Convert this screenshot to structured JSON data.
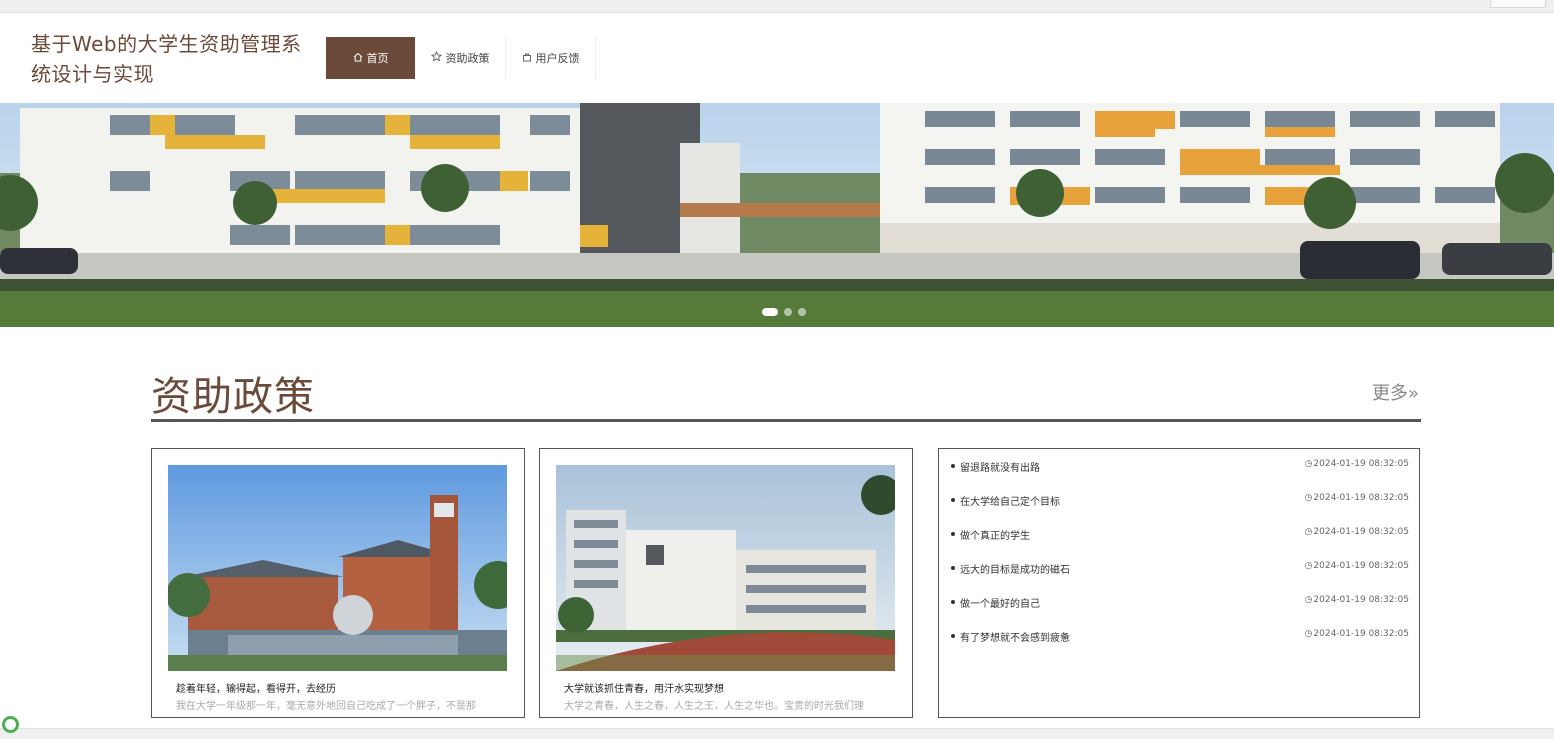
{
  "header": {
    "site_title": "基于Web的大学生资助管理系统设计与实现"
  },
  "nav": {
    "items": [
      {
        "label": "首页",
        "icon": "home-icon",
        "active": true
      },
      {
        "label": "资助政策",
        "icon": "star-icon",
        "active": false
      },
      {
        "label": "用户反馈",
        "icon": "bag-icon",
        "active": false
      }
    ]
  },
  "banner": {
    "slide_count": 3,
    "active_slide": 1
  },
  "section": {
    "title": "资助政策",
    "more_label": "更多»"
  },
  "cards": [
    {
      "title": "趁着年轻，输得起，看得开，去经历",
      "desc": "我在大学一年级那一年，毫无意外地回自己吃成了一个胖子，不是那"
    },
    {
      "title": "大学就该抓住青春，用汗水实现梦想",
      "desc": "大学之青春，人生之春，人生之王，人生之华也。宝贵的时光我们理"
    }
  ],
  "news_list": [
    {
      "title": "留退路就没有出路",
      "time": "2024-01-19 08:32:05"
    },
    {
      "title": "在大学给自己定个目标",
      "time": "2024-01-19 08:32:05"
    },
    {
      "title": "做个真正的学生",
      "time": "2024-01-19 08:32:05"
    },
    {
      "title": "远大的目标是成功的磁石",
      "time": "2024-01-19 08:32:05"
    },
    {
      "title": "做一个最好的自己",
      "time": "2024-01-19 08:32:05"
    },
    {
      "title": "有了梦想就不会感到疲惫",
      "time": "2024-01-19 08:32:05"
    }
  ],
  "colors": {
    "brand": "#6b4a3a",
    "border": "#555555"
  }
}
